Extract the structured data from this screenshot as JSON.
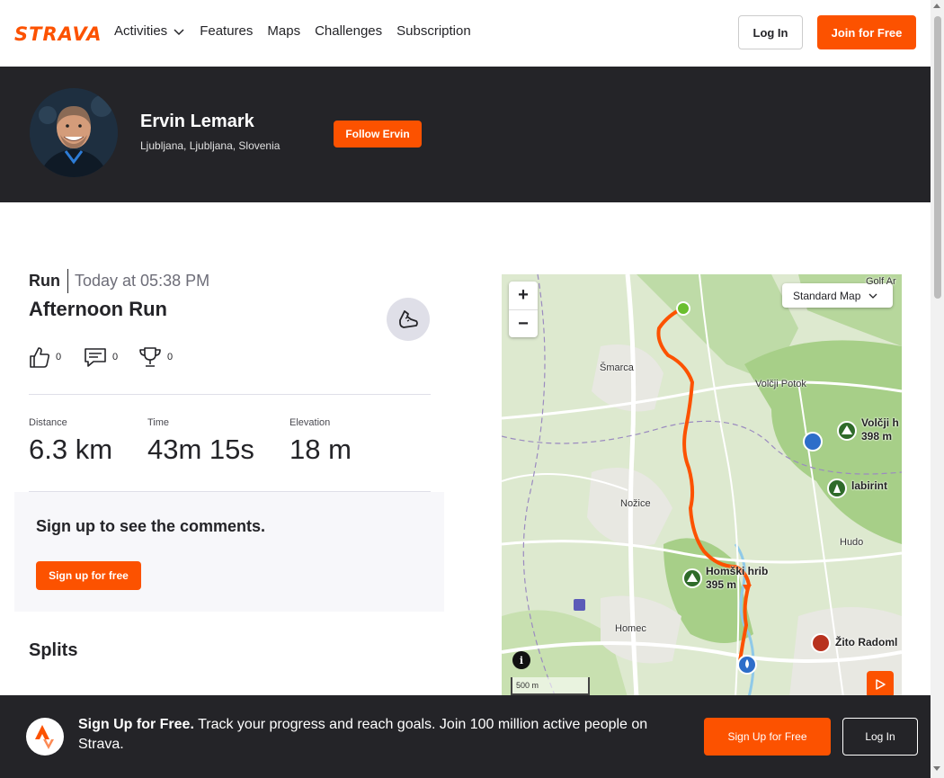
{
  "header": {
    "logo": "STRAVA",
    "nav": [
      "Activities",
      "Features",
      "Maps",
      "Challenges",
      "Subscription"
    ],
    "login_label": "Log In",
    "join_label": "Join for Free"
  },
  "athlete": {
    "name": "Ervin Lemark",
    "location": "Ljubljana, Ljubljana, Slovenia",
    "follow_label": "Follow Ervin"
  },
  "activity": {
    "type": "Run",
    "time": "Today at 05:38 PM",
    "title": "Afternoon Run",
    "kudos": "0",
    "comments": "0",
    "achievements": "0",
    "stats": [
      {
        "label": "Distance",
        "value": "6.3 km"
      },
      {
        "label": "Time",
        "value": "43m 15s"
      },
      {
        "label": "Elevation",
        "value": "18 m"
      }
    ]
  },
  "comments": {
    "heading": "Sign up to see the comments.",
    "button": "Sign up for free"
  },
  "splits": {
    "heading": "Splits"
  },
  "map": {
    "style_label": "Standard Map",
    "scale_label": "500 m",
    "places": {
      "smarca": "Šmarca",
      "volcji_potok": "Volčji Potok",
      "nozice": "Nožice",
      "hudo": "Hudo",
      "homec": "Homec",
      "golf": "Golf Ar",
      "labirint": "labirint",
      "zito": "Žito Radoml",
      "volcji_hrib_name": "Volčji h",
      "volcji_hrib_elev": "398 m",
      "homski_name": "Homški hrib",
      "homski_elev": "395 m"
    },
    "colors": {
      "route": "#fc5200",
      "start": "#6abf2e",
      "land": "#d6e8c8",
      "forest": "#a9d18e",
      "road": "#ffffff",
      "river": "#8fc9e8"
    }
  },
  "bottom_bar": {
    "bold_text": "Sign Up for Free.",
    "text": " Track your progress and reach goals. Join 100 million active people on Strava.",
    "signup_label": "Sign Up for Free",
    "login_label": "Log In"
  },
  "colors": {
    "brand": "#fc5200",
    "dark": "#242428"
  }
}
